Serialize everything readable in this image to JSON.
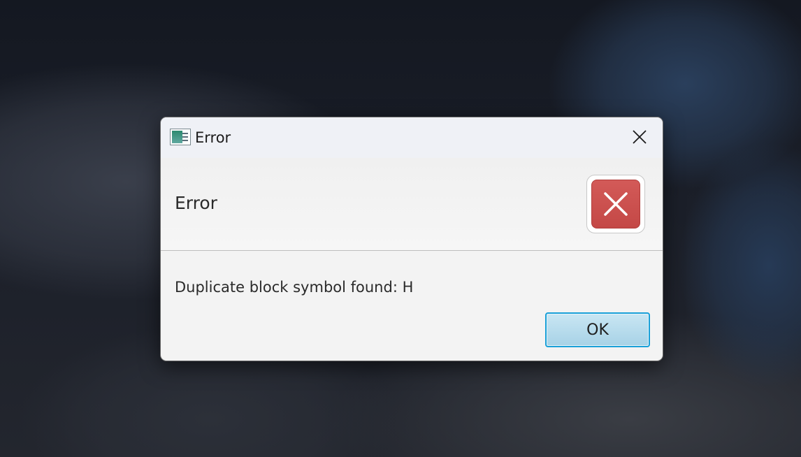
{
  "window": {
    "title": "Error",
    "app_icon": "java-app-icon",
    "close_icon": "close-icon"
  },
  "dialog": {
    "header_text": "Error",
    "header_icon": "error-x-icon",
    "message": "Duplicate block symbol found: H",
    "ok_label": "OK"
  },
  "colors": {
    "error_red": "#d0504e",
    "button_focus_border": "#1aa0d8",
    "button_fill": "#b7dcec"
  }
}
